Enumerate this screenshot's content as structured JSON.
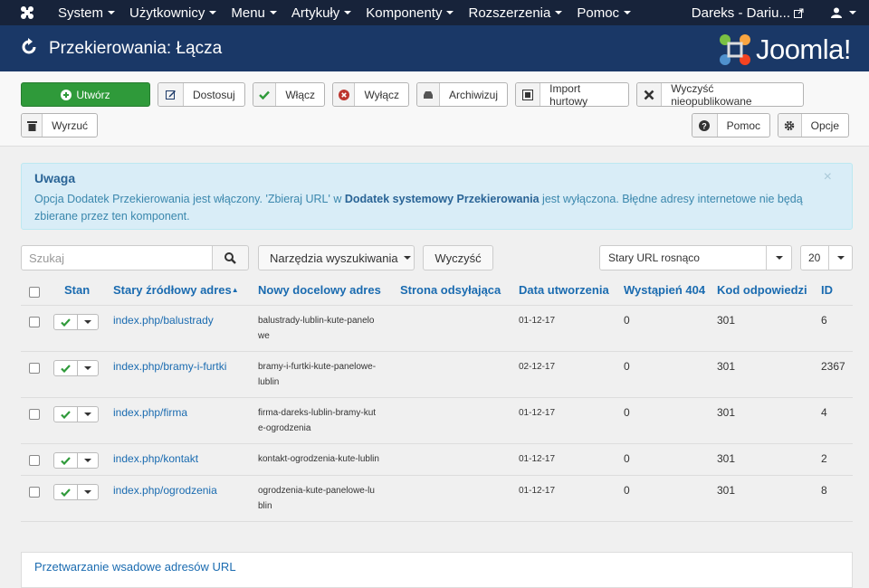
{
  "nav": {
    "menu": [
      "System",
      "Użytkownicy",
      "Menu",
      "Artykuły",
      "Komponenty",
      "Rozszerzenia",
      "Pomoc"
    ],
    "user_site": "Dareks - Dariu..."
  },
  "header": {
    "title": "Przekierowania: Łącza",
    "brand": "Joomla!"
  },
  "toolbar": {
    "new": "Utwórz",
    "edit": "Dostosuj",
    "enable": "Włącz",
    "disable": "Wyłącz",
    "archive": "Archiwizuj",
    "import": "Import hurtowy",
    "purge": "Wyczyść nieopublikowane",
    "trash": "Wyrzuć",
    "help": "Pomoc",
    "options": "Opcje"
  },
  "alert": {
    "title": "Uwaga",
    "text_a": "Opcja Dodatek Przekierowania jest włączony. 'Zbieraj URL' w ",
    "text_bold": "Dodatek systemowy Przekierowania",
    "text_b": " jest wyłączona. Błędne adresy internetowe nie będą zbierane przez ten komponent."
  },
  "filters": {
    "search_placeholder": "Szukaj",
    "tools": "Narzędzia wyszukiwania",
    "clear": "Wyczyść",
    "ordering": "Stary URL rosnąco",
    "limit": "20"
  },
  "table": {
    "headers": [
      "Stan",
      "Stary źródłowy adres",
      "Nowy docelowy adres",
      "Strona odsyłająca",
      "Data utworzenia",
      "Wystąpień 404",
      "Kod odpowiedzi",
      "ID"
    ],
    "rows": [
      {
        "old": "index.php/balustrady",
        "new1": "balustrady-lublin-kute-panelo",
        "new2": "we",
        "referer": "",
        "date": "01-12-17",
        "hits": "0",
        "code": "301",
        "id": "6"
      },
      {
        "old": "index.php/bramy-i-furtki",
        "new1": "bramy-i-furtki-kute-panelowe-",
        "new2": "lublin",
        "referer": "",
        "date": "02-12-17",
        "hits": "0",
        "code": "301",
        "id": "2367"
      },
      {
        "old": "index.php/firma",
        "new1": "firma-dareks-lublin-bramy-kut",
        "new2": "e-ogrodzenia",
        "referer": "",
        "date": "01-12-17",
        "hits": "0",
        "code": "301",
        "id": "4"
      },
      {
        "old": "index.php/kontakt",
        "new1": "kontakt-ogrodzenia-kute-lublin",
        "new2": "",
        "referer": "",
        "date": "01-12-17",
        "hits": "0",
        "code": "301",
        "id": "2"
      },
      {
        "old": "index.php/ogrodzenia",
        "new1": "ogrodzenia-kute-panelowe-lu",
        "new2": "blin",
        "referer": "",
        "date": "01-12-17",
        "hits": "0",
        "code": "301",
        "id": "8"
      }
    ]
  },
  "batch": {
    "title": "Przetwarzanie wsadowe adresów URL"
  }
}
